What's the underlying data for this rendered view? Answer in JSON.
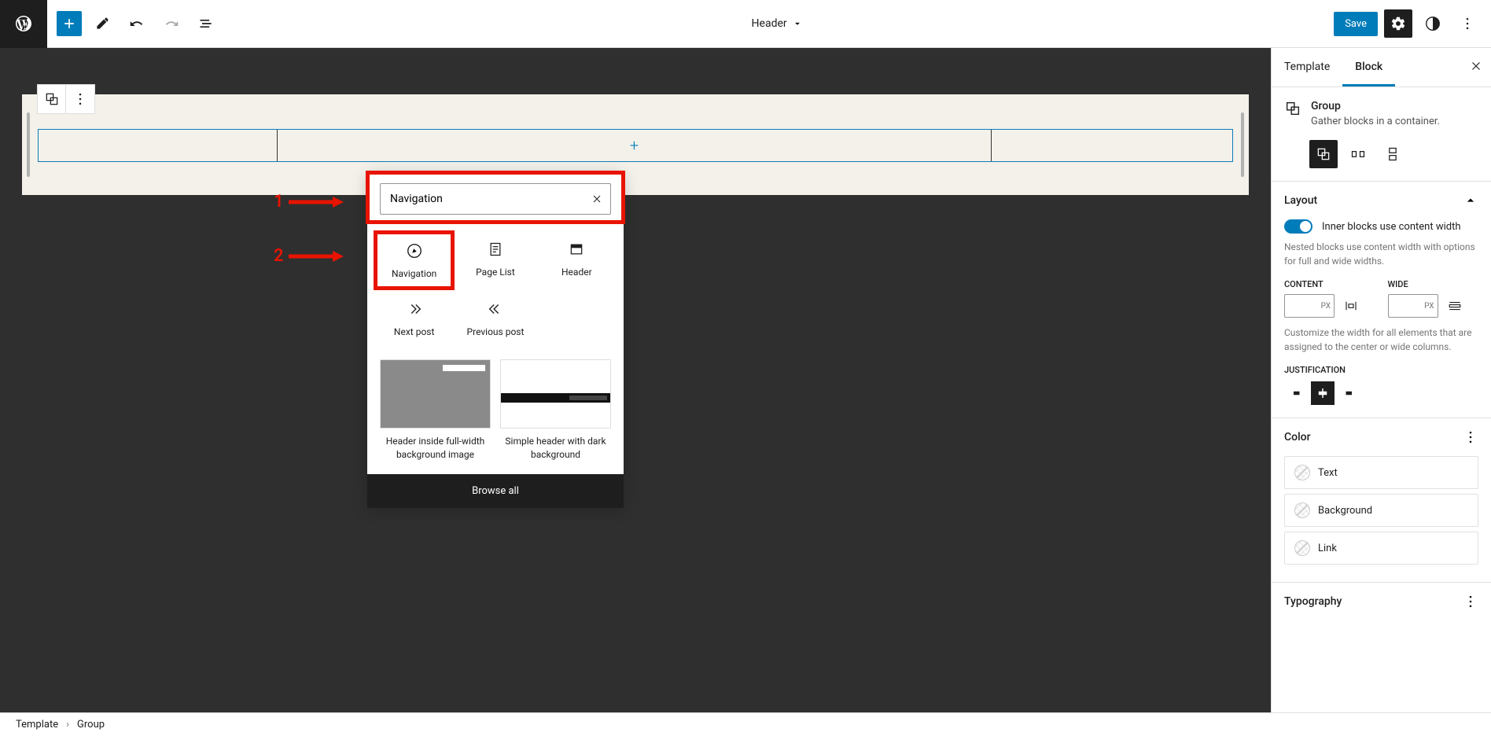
{
  "toolbar": {
    "title": "Header",
    "save_label": "Save"
  },
  "sidebar": {
    "tabs": {
      "template": "Template",
      "block": "Block"
    },
    "group": {
      "title": "Group",
      "desc": "Gather blocks in a container."
    },
    "layout": {
      "title": "Layout",
      "toggle_label": "Inner blocks use content width",
      "toggle_help": "Nested blocks use content width with options for full and wide widths.",
      "content_label": "CONTENT",
      "wide_label": "WIDE",
      "unit": "PX",
      "width_help": "Customize the width for all elements that are assigned to the center or wide columns.",
      "justification_label": "JUSTIFICATION"
    },
    "color": {
      "title": "Color",
      "text": "Text",
      "background": "Background",
      "link": "Link"
    },
    "typography": {
      "title": "Typography"
    }
  },
  "inserter": {
    "search_value": "Navigation",
    "blocks": [
      {
        "name": "Navigation"
      },
      {
        "name": "Page List"
      },
      {
        "name": "Header"
      },
      {
        "name": "Next post"
      },
      {
        "name": "Previous post"
      }
    ],
    "patterns": [
      {
        "label": "Header inside full-width background image"
      },
      {
        "label": "Simple header with dark background"
      }
    ],
    "browse_all": "Browse all"
  },
  "annotations": {
    "one": "1",
    "two": "2"
  },
  "footer": {
    "crumb1": "Template",
    "crumb2": "Group"
  }
}
